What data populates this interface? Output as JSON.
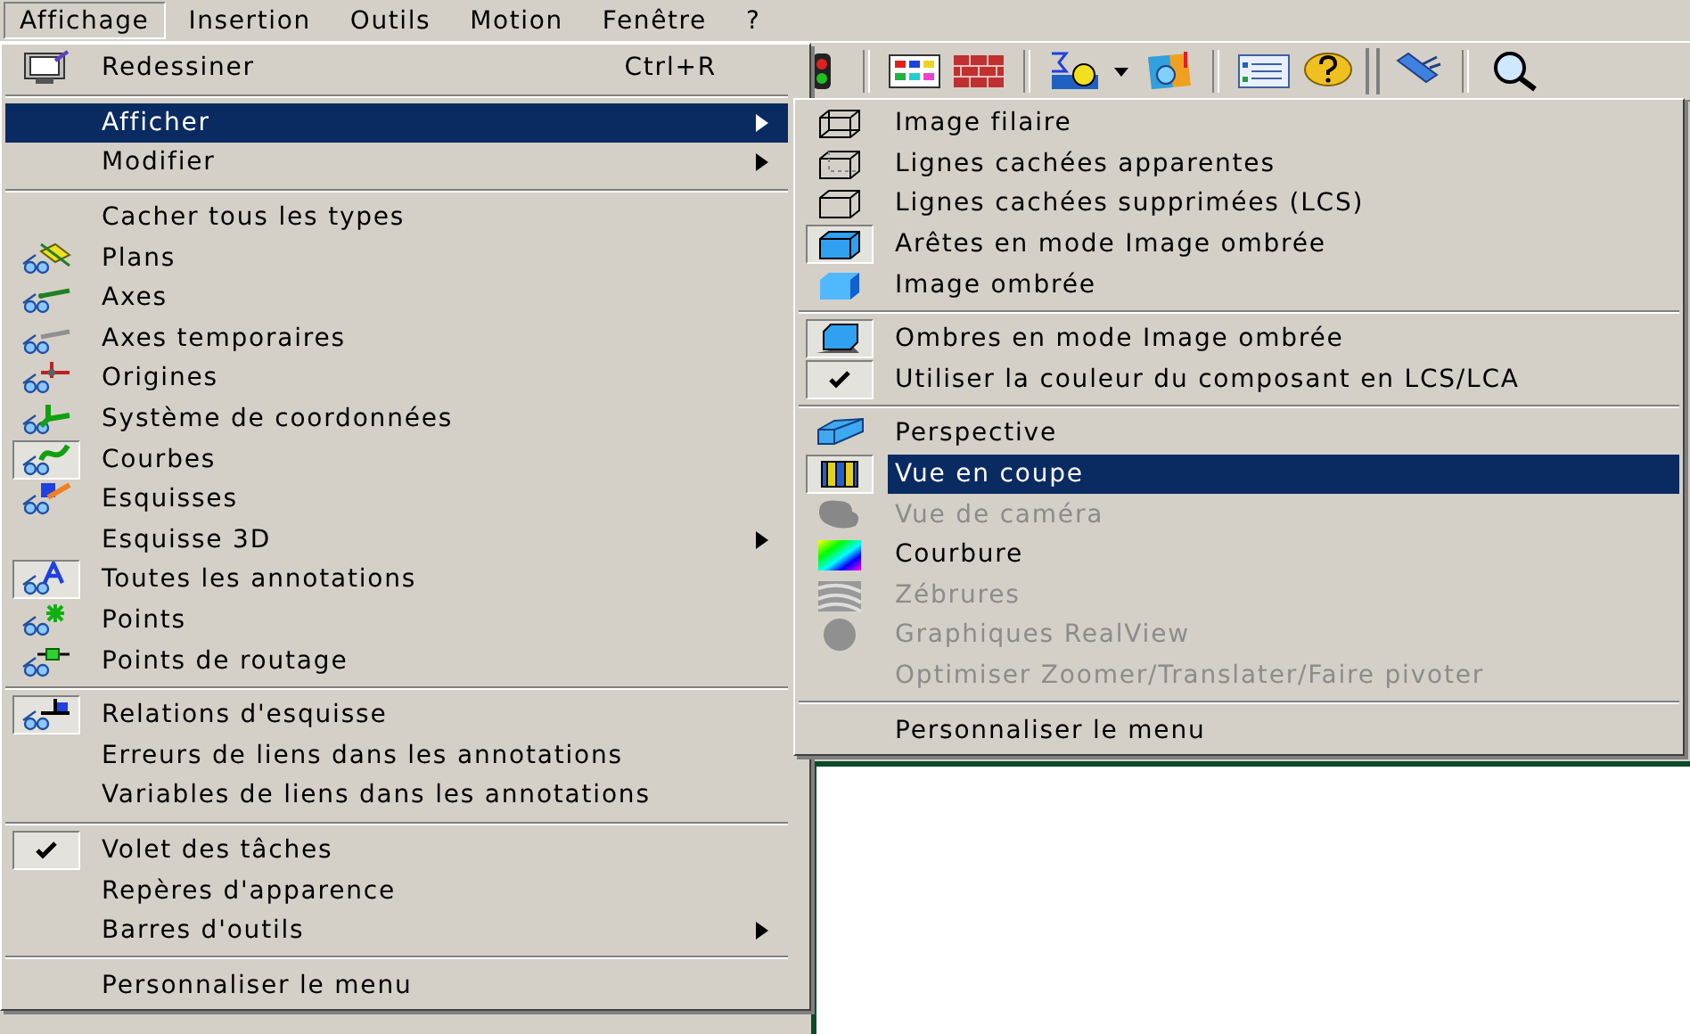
{
  "menubar": [
    {
      "label": "Affichage",
      "selected": true
    },
    {
      "label": "Insertion",
      "selected": false
    },
    {
      "label": "Outils",
      "selected": false
    },
    {
      "label": "Motion",
      "selected": false
    },
    {
      "label": "Fenêtre",
      "selected": false
    },
    {
      "label": "?",
      "selected": false
    }
  ],
  "menu": {
    "items": [
      {
        "kind": "item",
        "label": "Redessiner",
        "shortcut": "Ctrl+R",
        "selected": false,
        "checked": false,
        "disabled": false,
        "submenu": false
      },
      {
        "kind": "separator"
      },
      {
        "kind": "item",
        "label": "Afficher",
        "selected": true,
        "checked": false,
        "disabled": false,
        "submenu": true
      },
      {
        "kind": "item",
        "label": "Modifier",
        "selected": false,
        "checked": false,
        "disabled": false,
        "submenu": true
      },
      {
        "kind": "separator"
      },
      {
        "kind": "item",
        "label": "Cacher tous les types",
        "selected": false,
        "checked": false,
        "disabled": false,
        "submenu": false
      },
      {
        "kind": "item",
        "label": "Plans",
        "selected": false,
        "checked": false,
        "disabled": false,
        "submenu": false
      },
      {
        "kind": "item",
        "label": "Axes",
        "selected": false,
        "checked": false,
        "disabled": false,
        "submenu": false
      },
      {
        "kind": "item",
        "label": "Axes temporaires",
        "selected": false,
        "checked": false,
        "disabled": false,
        "submenu": false
      },
      {
        "kind": "item",
        "label": "Origines",
        "selected": false,
        "checked": false,
        "disabled": false,
        "submenu": false
      },
      {
        "kind": "item",
        "label": "Système de coordonnées",
        "selected": false,
        "checked": false,
        "disabled": false,
        "submenu": false
      },
      {
        "kind": "item",
        "label": "Courbes",
        "selected": false,
        "checked": true,
        "disabled": false,
        "submenu": false
      },
      {
        "kind": "item",
        "label": "Esquisses",
        "selected": false,
        "checked": false,
        "disabled": false,
        "submenu": false
      },
      {
        "kind": "item",
        "label": "Esquisse 3D",
        "selected": false,
        "checked": false,
        "disabled": false,
        "submenu": true
      },
      {
        "kind": "item",
        "label": "Toutes les annotations",
        "selected": false,
        "checked": true,
        "disabled": false,
        "submenu": false
      },
      {
        "kind": "item",
        "label": "Points",
        "selected": false,
        "checked": false,
        "disabled": false,
        "submenu": false
      },
      {
        "kind": "item",
        "label": "Points de routage",
        "selected": false,
        "checked": false,
        "disabled": false,
        "submenu": false
      },
      {
        "kind": "separator"
      },
      {
        "kind": "item",
        "label": "Relations d'esquisse",
        "selected": false,
        "checked": true,
        "disabled": false,
        "submenu": false
      },
      {
        "kind": "item",
        "label": "Erreurs de liens dans les annotations",
        "selected": false,
        "checked": false,
        "disabled": false,
        "submenu": false
      },
      {
        "kind": "item",
        "label": "Variables de liens dans les annotations",
        "selected": false,
        "checked": false,
        "disabled": false,
        "submenu": false
      },
      {
        "kind": "separator"
      },
      {
        "kind": "item",
        "label": "Volet des tâches",
        "selected": false,
        "checked": true,
        "disabled": false,
        "submenu": false
      },
      {
        "kind": "item",
        "label": "Repères d'apparence",
        "selected": false,
        "checked": false,
        "disabled": false,
        "submenu": false
      },
      {
        "kind": "item",
        "label": "Barres d'outils",
        "selected": false,
        "checked": false,
        "disabled": false,
        "submenu": true
      },
      {
        "kind": "separator"
      },
      {
        "kind": "item",
        "label": "Personnaliser le menu",
        "selected": false,
        "checked": false,
        "disabled": false,
        "submenu": false
      }
    ]
  },
  "submenu": {
    "items": [
      {
        "kind": "item",
        "label": "Image filaire",
        "selected": false,
        "checked": false,
        "disabled": false
      },
      {
        "kind": "item",
        "label": "Lignes cachées apparentes",
        "selected": false,
        "checked": false,
        "disabled": false
      },
      {
        "kind": "item",
        "label": "Lignes cachées supprimées (LCS)",
        "selected": false,
        "checked": false,
        "disabled": false
      },
      {
        "kind": "item",
        "label": "Arêtes en mode Image ombrée",
        "selected": false,
        "checked": true,
        "disabled": false
      },
      {
        "kind": "item",
        "label": "Image ombrée",
        "selected": false,
        "checked": false,
        "disabled": false
      },
      {
        "kind": "separator"
      },
      {
        "kind": "item",
        "label": "Ombres en mode Image ombrée",
        "selected": false,
        "checked": true,
        "disabled": false
      },
      {
        "kind": "item",
        "label": "Utiliser la couleur du composant en LCS/LCA",
        "selected": false,
        "checked": true,
        "disabled": false
      },
      {
        "kind": "separator"
      },
      {
        "kind": "item",
        "label": "Perspective",
        "selected": false,
        "checked": false,
        "disabled": false
      },
      {
        "kind": "item",
        "label": "Vue en coupe",
        "selected": true,
        "checked": true,
        "disabled": false
      },
      {
        "kind": "item",
        "label": "Vue de caméra",
        "selected": false,
        "checked": false,
        "disabled": true
      },
      {
        "kind": "item",
        "label": "Courbure",
        "selected": false,
        "checked": false,
        "disabled": false
      },
      {
        "kind": "item",
        "label": "Zébrures",
        "selected": false,
        "checked": false,
        "disabled": true
      },
      {
        "kind": "item",
        "label": "Graphiques RealView",
        "selected": false,
        "checked": false,
        "disabled": true
      },
      {
        "kind": "item",
        "label": "Optimiser Zoomer/Translater/Faire pivoter",
        "selected": false,
        "checked": false,
        "disabled": true
      },
      {
        "kind": "separator"
      },
      {
        "kind": "item",
        "label": "Personnaliser le menu",
        "selected": false,
        "checked": false,
        "disabled": false
      }
    ]
  }
}
